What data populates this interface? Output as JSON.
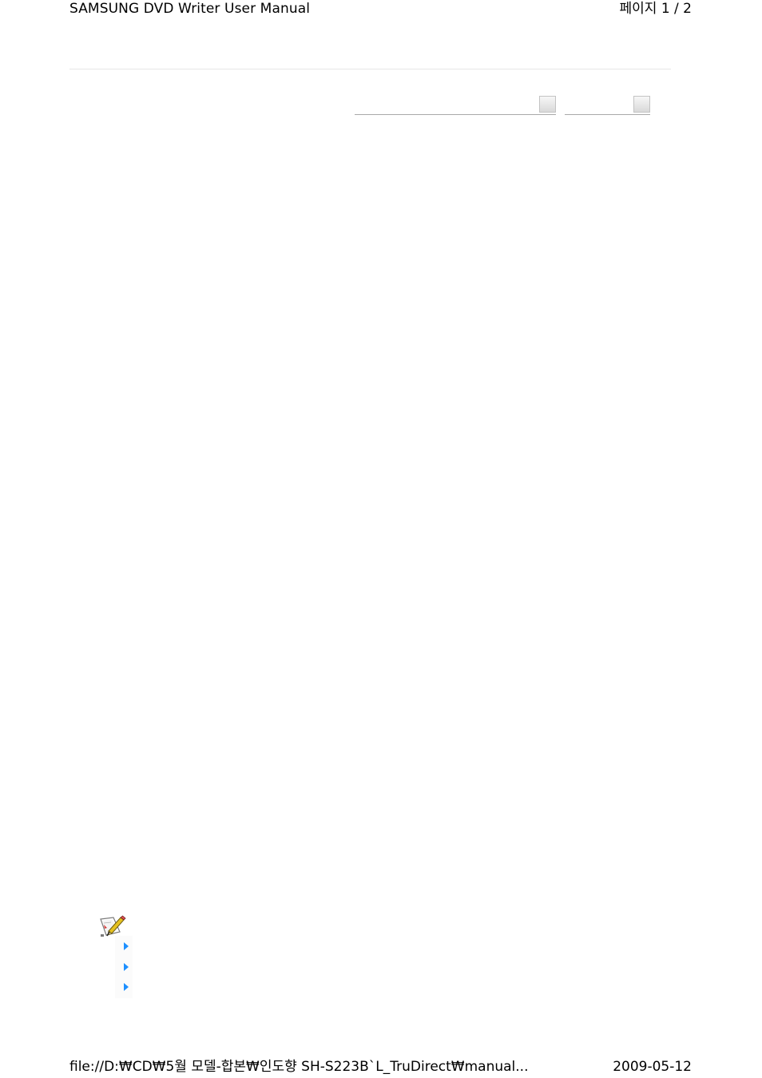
{
  "print_header": {
    "title": "SAMSUNG DVD Writer User Manual",
    "page_indicator": "페이지 1 / 2"
  },
  "print_footer": {
    "file_path": "file://D:₩CD₩5월 모델-합본₩인도향 SH-S223B`L_TruDirect₩manual...",
    "date": "2009-05-12"
  },
  "selectors": [
    {
      "value": ""
    },
    {
      "value": ""
    }
  ],
  "note": {
    "icon": "note-pencil-icon",
    "bullets": [
      {
        "icon": "blue-triangle-bullet-icon",
        "text": ""
      },
      {
        "icon": "blue-triangle-bullet-icon",
        "text": ""
      },
      {
        "icon": "blue-triangle-bullet-icon",
        "text": ""
      }
    ]
  },
  "colors": {
    "bullet_blue": "#1e90ff",
    "rule_gray": "#e6e6e6"
  }
}
